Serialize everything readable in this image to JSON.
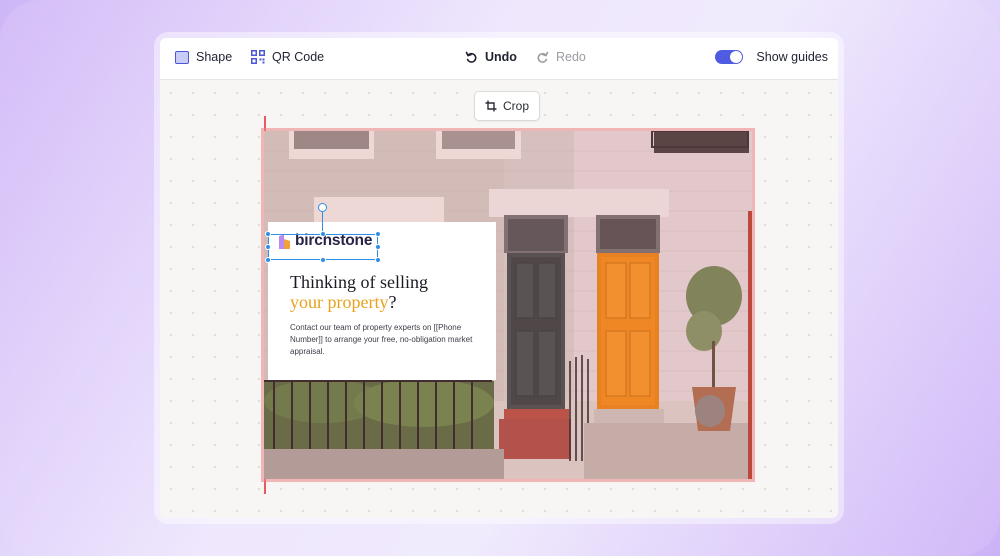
{
  "toolbar": {
    "shape_label": "Shape",
    "qr_label": "QR Code",
    "undo_label": "Undo",
    "redo_label": "Redo",
    "guides_label": "Show guides",
    "guides_on": true,
    "accent_color": "#4f5be0"
  },
  "crop": {
    "label": "Crop"
  },
  "design": {
    "brand": "birchstone",
    "headline_line1": "Thinking of selling",
    "headline_accent": "your property",
    "headline_end": "?",
    "body": "Contact our team of property experts on [[Phone Number]] to arrange your free, no-obligation market appraisal.",
    "accent_color": "#e9a21c"
  }
}
